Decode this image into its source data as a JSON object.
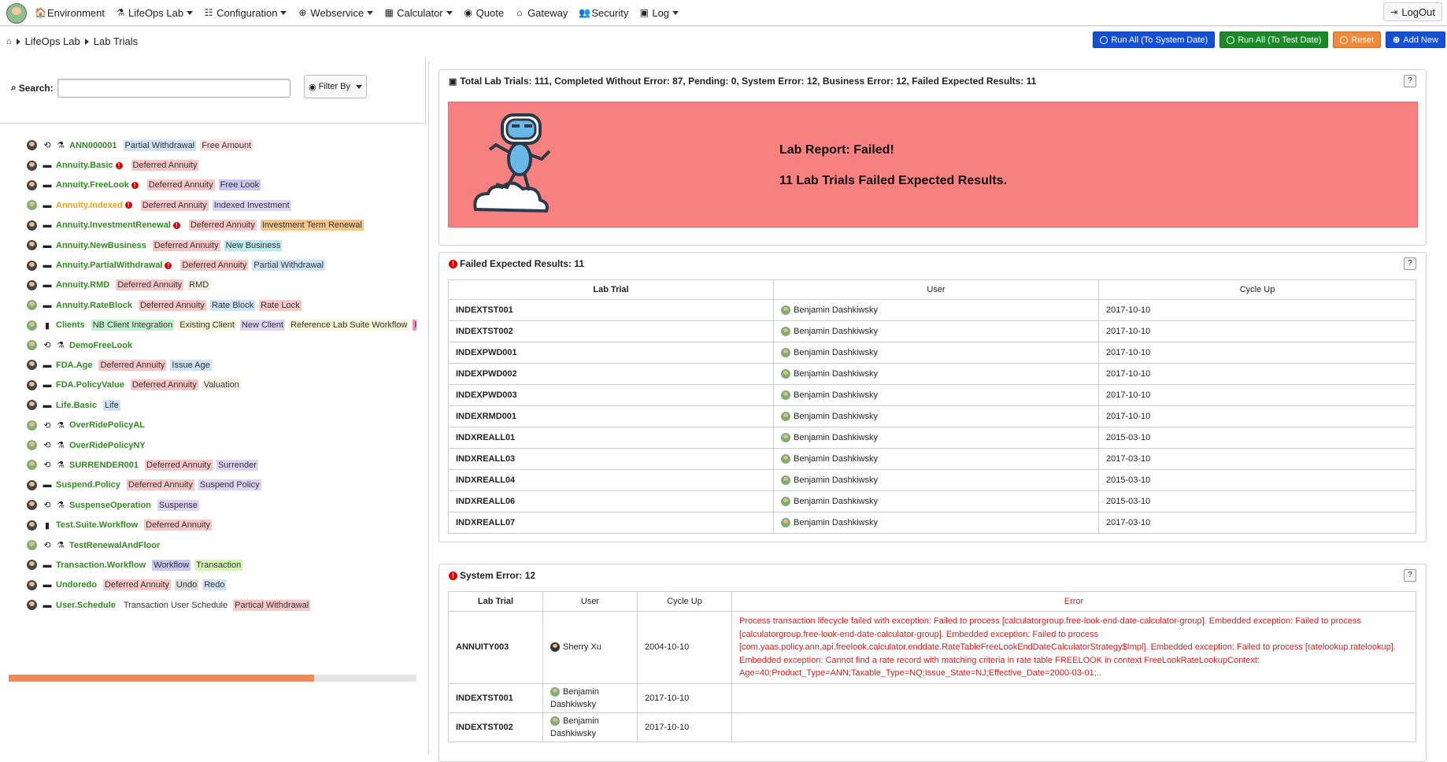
{
  "nav": {
    "items": [
      {
        "icon": "home-cog-icon",
        "glyph": "🏠",
        "label": "Environment",
        "caret": false
      },
      {
        "icon": "flask-icon",
        "glyph": "⚗",
        "label": "LifeOps Lab",
        "caret": true
      },
      {
        "icon": "tasks-icon",
        "glyph": "☷",
        "label": "Configuration",
        "caret": true
      },
      {
        "icon": "globe-icon",
        "glyph": "⊕",
        "label": "Webservice",
        "caret": true
      },
      {
        "icon": "calculator-icon",
        "glyph": "▦",
        "label": "Calculator",
        "caret": true
      },
      {
        "icon": "eye-icon",
        "glyph": "◉",
        "label": "Quote",
        "caret": false
      },
      {
        "icon": "bank-icon",
        "glyph": "⌂",
        "label": "Gateway",
        "caret": false
      },
      {
        "icon": "users-icon",
        "glyph": "👥",
        "label": "Security",
        "caret": false
      },
      {
        "icon": "log-icon",
        "glyph": "▣",
        "label": "Log",
        "caret": true
      }
    ],
    "logout": "LogOut"
  },
  "breadcrumb": {
    "home": "home",
    "items": [
      "LifeOps Lab",
      "Lab Trials"
    ]
  },
  "actions": {
    "run_system": "Run All (To System Date)",
    "run_test": "Run All (To Test Date)",
    "reset": "Reset",
    "add_new": "Add New"
  },
  "search": {
    "label": "Search:",
    "value": "",
    "filter_label": "Filter By"
  },
  "tree": [
    {
      "name": "ANN000001",
      "icon": "flask",
      "warn": false,
      "avatar": "dark",
      "tags": [
        {
          "t": "Partial Withdrawal",
          "c": "blue"
        },
        {
          "t": "Free Amount",
          "c": "lightpink"
        }
      ]
    },
    {
      "name": "Annuity.Basic",
      "icon": "box",
      "warn": true,
      "avatar": "dark",
      "tags": [
        {
          "t": "Deferred Annuity",
          "c": "pink"
        }
      ]
    },
    {
      "name": "Annuity.FreeLook",
      "icon": "box",
      "warn": true,
      "avatar": "dark",
      "tags": [
        {
          "t": "Deferred Annuity",
          "c": "pink"
        },
        {
          "t": "Free Look",
          "c": "purple"
        }
      ]
    },
    {
      "name": "Annuity.Indexed",
      "icon": "box",
      "warn": true,
      "avatar": "green",
      "orange": true,
      "tags": [
        {
          "t": "Deferred Annuity",
          "c": "pink"
        },
        {
          "t": "Indexed Investment",
          "c": "lav"
        }
      ]
    },
    {
      "name": "Annuity.InvestmentRenewal",
      "icon": "box",
      "warn": true,
      "avatar": "dark",
      "tags": [
        {
          "t": "Deferred Annuity",
          "c": "pink"
        },
        {
          "t": "Investment Term Renewal",
          "c": "orange"
        }
      ]
    },
    {
      "name": "Annuity.NewBusiness",
      "icon": "box",
      "warn": false,
      "avatar": "dark",
      "tags": [
        {
          "t": "Deferred Annuity",
          "c": "pink"
        },
        {
          "t": "New Business",
          "c": "cyan"
        }
      ]
    },
    {
      "name": "Annuity.PartialWithdrawal",
      "icon": "box",
      "warn": true,
      "avatar": "dark",
      "tags": [
        {
          "t": "Deferred Annuity",
          "c": "pink"
        },
        {
          "t": "Partial Withdrawal",
          "c": "blue"
        }
      ]
    },
    {
      "name": "Annuity.RMD",
      "icon": "box",
      "warn": false,
      "avatar": "dark",
      "tags": [
        {
          "t": "Deferred Annuity",
          "c": "pink"
        },
        {
          "t": "RMD",
          "c": "beige"
        }
      ]
    },
    {
      "name": "Annuity.RateBlock",
      "icon": "box",
      "warn": false,
      "avatar": "green",
      "tags": [
        {
          "t": "Deferred Annuity",
          "c": "pink"
        },
        {
          "t": "Rate Block",
          "c": "blue"
        },
        {
          "t": "Rate Lock",
          "c": "pink"
        }
      ]
    },
    {
      "name": "Clients",
      "icon": "suitcase",
      "warn": false,
      "avatar": "green",
      "tags": [
        {
          "t": "NB Client Integration",
          "c": "green"
        },
        {
          "t": "Existing Client",
          "c": "yellow"
        },
        {
          "t": "New Client",
          "c": "lav"
        },
        {
          "t": "Reference Lab Suite Workflow",
          "c": "yellow"
        },
        {
          "t": "Refer",
          "c": "rose"
        }
      ]
    },
    {
      "name": "DemoFreeLook",
      "icon": "flask",
      "warn": false,
      "avatar": "green",
      "tags": []
    },
    {
      "name": "FDA.Age",
      "icon": "box",
      "warn": false,
      "avatar": "dark",
      "tags": [
        {
          "t": "Deferred Annuity",
          "c": "pink"
        },
        {
          "t": "Issue Age",
          "c": "blue"
        }
      ]
    },
    {
      "name": "FDA.PolicyValue",
      "icon": "box",
      "warn": false,
      "avatar": "dark",
      "tags": [
        {
          "t": "Deferred Annuity",
          "c": "pink"
        },
        {
          "t": "Valuation",
          "c": "beige"
        }
      ]
    },
    {
      "name": "Life.Basic",
      "icon": "box",
      "warn": false,
      "avatar": "dark",
      "tags": [
        {
          "t": "Life",
          "c": "blue"
        }
      ]
    },
    {
      "name": "OverRidePolicyAL",
      "icon": "flask",
      "warn": false,
      "avatar": "green",
      "tags": []
    },
    {
      "name": "OverRidePolicyNY",
      "icon": "flask",
      "warn": false,
      "avatar": "green",
      "tags": []
    },
    {
      "name": "SURRENDER001",
      "icon": "flask",
      "warn": false,
      "avatar": "green",
      "tags": [
        {
          "t": "Deferred Annuity",
          "c": "pink"
        },
        {
          "t": "Surrender",
          "c": "lav"
        }
      ]
    },
    {
      "name": "Suspend.Policy",
      "icon": "box",
      "warn": false,
      "avatar": "dark",
      "tags": [
        {
          "t": "Deferred Annuity",
          "c": "pink"
        },
        {
          "t": "Suspend Policy",
          "c": "lav"
        }
      ]
    },
    {
      "name": "SuspenseOperation",
      "icon": "flask",
      "warn": false,
      "avatar": "dark",
      "tags": [
        {
          "t": "Suspense",
          "c": "lav"
        }
      ]
    },
    {
      "name": "Test.Suite.Workflow",
      "icon": "suitcase",
      "warn": false,
      "avatar": "dark",
      "tags": [
        {
          "t": "Deferred Annuity",
          "c": "pink"
        }
      ]
    },
    {
      "name": "TestRenewalAndFloor",
      "icon": "flask",
      "warn": false,
      "avatar": "green",
      "tags": []
    },
    {
      "name": "Transaction.Workflow",
      "icon": "box",
      "warn": false,
      "avatar": "dark",
      "tags": [
        {
          "t": "Workflow",
          "c": "purple"
        },
        {
          "t": "Transaction",
          "c": "lime"
        }
      ]
    },
    {
      "name": "Undoredo",
      "icon": "box",
      "warn": false,
      "avatar": "dark",
      "tags": [
        {
          "t": "Deferred Annuity",
          "c": "pink"
        },
        {
          "t": "Undo",
          "c": "grey"
        },
        {
          "t": "Redo",
          "c": "blue"
        }
      ]
    },
    {
      "name": "User.Schedule",
      "icon": "box",
      "warn": false,
      "avatar": "dark",
      "tags": [
        {
          "t": "Transaction User Schedule",
          "c": "none"
        },
        {
          "t": "Partical Withdrawal",
          "c": "pink"
        }
      ]
    }
  ],
  "summary": {
    "title": "Total Lab Trials: 111, Completed Without Error: 87, Pending: 0, System Error: 12, Business Error: 12, Failed Expected Results: 11",
    "report_title": "Lab Report: Failed!",
    "report_sub": "11 Lab Trials Failed Expected Results.",
    "help": "?",
    "report_color": "#f78080"
  },
  "failed": {
    "title": "Failed Expected Results: 11",
    "help": "?",
    "headers": [
      "Lab Trial",
      "User",
      "Cycle Up"
    ],
    "rows": [
      [
        "INDEXTST001",
        "Benjamin Dashkiwsky",
        "2017-10-10"
      ],
      [
        "INDEXTST002",
        "Benjamin Dashkiwsky",
        "2017-10-10"
      ],
      [
        "INDEXPWD001",
        "Benjamin Dashkiwsky",
        "2017-10-10"
      ],
      [
        "INDEXPWD002",
        "Benjamin Dashkiwsky",
        "2017-10-10"
      ],
      [
        "INDEXPWD003",
        "Benjamin Dashkiwsky",
        "2017-10-10"
      ],
      [
        "INDEXRMD001",
        "Benjamin Dashkiwsky",
        "2017-10-10"
      ],
      [
        "INDXREALL01",
        "Benjamin Dashkiwsky",
        "2015-03-10"
      ],
      [
        "INDXREALL03",
        "Benjamin Dashkiwsky",
        "2017-03-10"
      ],
      [
        "INDXREALL04",
        "Benjamin Dashkiwsky",
        "2015-03-10"
      ],
      [
        "INDXREALL06",
        "Benjamin Dashkiwsky",
        "2015-03-10"
      ],
      [
        "INDXREALL07",
        "Benjamin Dashkiwsky",
        "2017-03-10"
      ]
    ]
  },
  "syserr": {
    "title": "System Error: 12",
    "help": "?",
    "headers": [
      "Lab Trial",
      "User",
      "Cycle Up",
      "Error"
    ],
    "rows": [
      {
        "trial": "ANNUITY003",
        "user": "Sherry Xu",
        "date": "2004-10-10",
        "error": "Process transaction lifecycle failed with exception: Failed to process [calculatorgroup.free-look-end-date-calculator-group]. Embedded exception: Failed to process [calculatorgroup.free-look-end-date-calculator-group]. Embedded exception: Failed to process [com.yaas.policy.ann.api.freelook.calculator.enddate.RateTableFreeLookEndDateCalculatorStrategy$Impl]. Embedded exception: Failed to process [ratelookup.ratelookup]. Embedded exception: Cannot find a rate record with matching criteria in rate table FREELOOK in context FreeLookRateLookupContext: Age=40;Product_Type=ANN;Taxable_Type=NQ;Issue_State=NJ;Effective_Date=2000-03-01;.."
      },
      {
        "trial": "INDEXTST001",
        "user": "Benjamin Dashkiwsky",
        "date": "2017-10-10",
        "error": ""
      },
      {
        "trial": "INDEXTST002",
        "user": "Benjamin Dashkiwsky",
        "date": "2017-10-10",
        "error": ""
      }
    ]
  }
}
